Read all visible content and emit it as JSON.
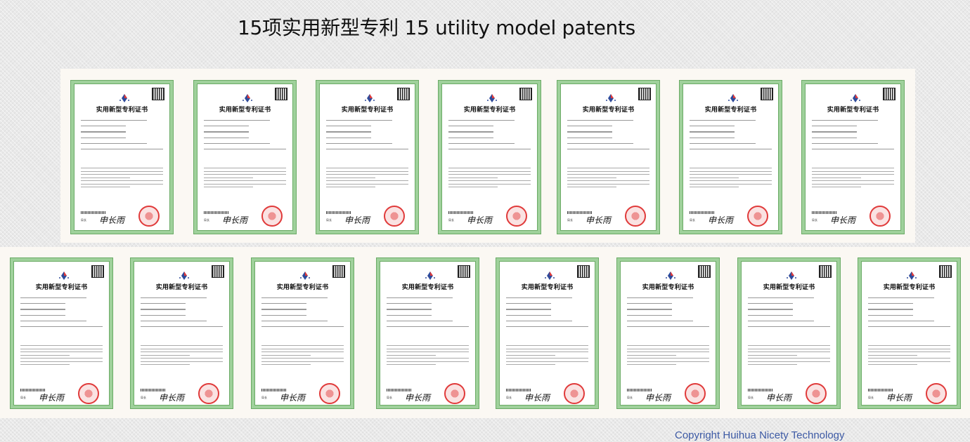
{
  "page": {
    "title": "15项实用新型专利 15 utility model patents",
    "copyright": "Copyright Huihua Nicety Technology"
  },
  "certificates": {
    "title": "实用新型专利证书",
    "sign_label": "局长\n申长雨",
    "signature": "申长雨",
    "row1_count": 7,
    "row2_count": 8
  },
  "colors": {
    "border": "#9fd19b",
    "seal": "#e03a3a",
    "copyright": "#3d5aa5",
    "band": "#fbf8f3"
  }
}
